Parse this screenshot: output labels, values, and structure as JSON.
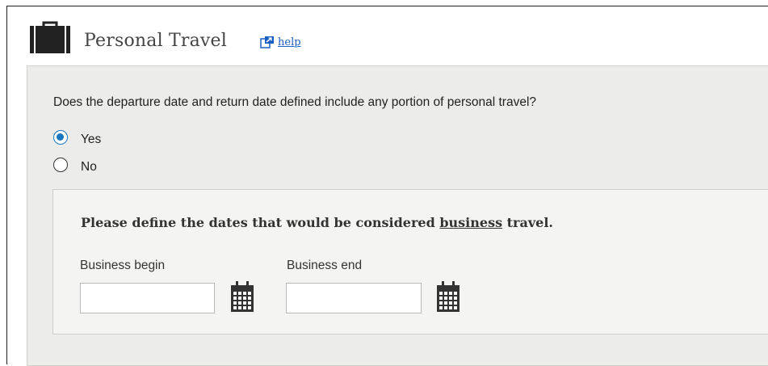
{
  "section": {
    "title": "Personal Travel",
    "help_label": "help",
    "icon": "briefcase-icon"
  },
  "question": {
    "text": "Does the departure date and return date defined include any portion of personal travel?",
    "options": [
      {
        "label": "Yes",
        "selected": true
      },
      {
        "label": "No",
        "selected": false
      }
    ]
  },
  "business_dates": {
    "instruction_prefix": "Please define the dates that would be considered ",
    "instruction_emphasis": "business",
    "instruction_suffix": " travel.",
    "begin": {
      "label": "Business begin",
      "value": "",
      "placeholder": ""
    },
    "end": {
      "label": "Business end",
      "value": "",
      "placeholder": ""
    }
  },
  "colors": {
    "accent": "#1a78c2",
    "link": "#1a5ec2",
    "panel_bg": "#ecedea",
    "inner_bg": "#f4f4f2"
  }
}
